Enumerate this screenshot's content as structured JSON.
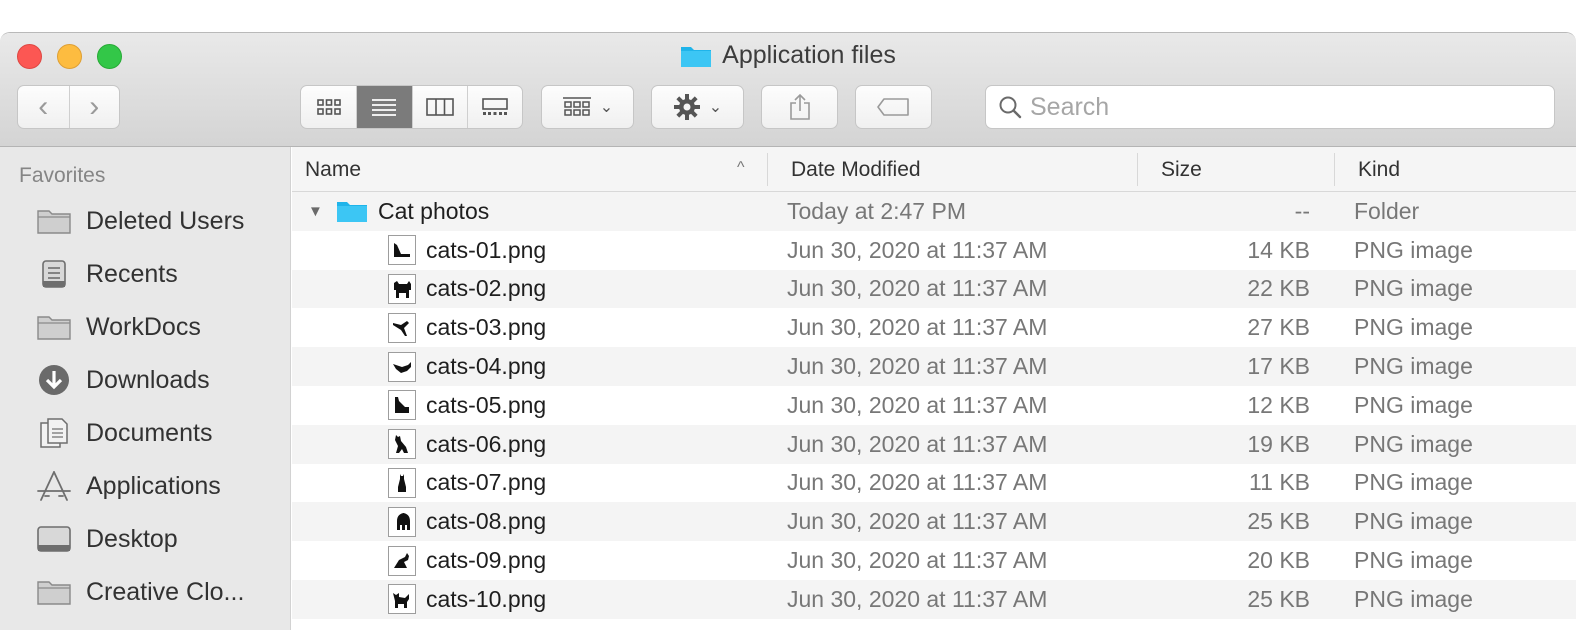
{
  "window": {
    "title": "Application files",
    "colors": {
      "close": "#fc5753",
      "minimize": "#fdbc40",
      "maximize": "#33c748",
      "folder": "#1fb4ea"
    }
  },
  "toolbar": {
    "back_icon": "chevron-left-icon",
    "forward_icon": "chevron-right-icon",
    "views": [
      "icon-view-icon",
      "list-view-icon",
      "column-view-icon",
      "gallery-view-icon"
    ],
    "active_view": "list",
    "group_icon": "group-icon",
    "action_icon": "gear-icon",
    "share_icon": "share-icon",
    "tag_icon": "tag-icon"
  },
  "search": {
    "placeholder": "Search",
    "value": ""
  },
  "sidebar": {
    "heading": "Favorites",
    "items": [
      {
        "label": "Deleted Users",
        "icon": "folder-icon"
      },
      {
        "label": "Recents",
        "icon": "recents-icon"
      },
      {
        "label": "WorkDocs",
        "icon": "folder-icon"
      },
      {
        "label": "Downloads",
        "icon": "download-icon"
      },
      {
        "label": "Documents",
        "icon": "document-icon"
      },
      {
        "label": "Applications",
        "icon": "applications-icon"
      },
      {
        "label": "Desktop",
        "icon": "desktop-icon"
      },
      {
        "label": "Creative Clo...",
        "icon": "folder-icon"
      }
    ]
  },
  "columns": {
    "name": "Name",
    "date": "Date Modified",
    "size": "Size",
    "kind": "Kind",
    "sort_indicator": "^"
  },
  "folder_row": {
    "disclosure": "▼",
    "name": "Cat photos",
    "date": "Today at 2:47 PM",
    "size": "--",
    "kind": "Folder"
  },
  "files": [
    {
      "name": "cats-01.png",
      "date": "Jun 30, 2020 at 11:37 AM",
      "size": "14 KB",
      "kind": "PNG image"
    },
    {
      "name": "cats-02.png",
      "date": "Jun 30, 2020 at 11:37 AM",
      "size": "22 KB",
      "kind": "PNG image"
    },
    {
      "name": "cats-03.png",
      "date": "Jun 30, 2020 at 11:37 AM",
      "size": "27 KB",
      "kind": "PNG image"
    },
    {
      "name": "cats-04.png",
      "date": "Jun 30, 2020 at 11:37 AM",
      "size": "17 KB",
      "kind": "PNG image"
    },
    {
      "name": "cats-05.png",
      "date": "Jun 30, 2020 at 11:37 AM",
      "size": "12 KB",
      "kind": "PNG image"
    },
    {
      "name": "cats-06.png",
      "date": "Jun 30, 2020 at 11:37 AM",
      "size": "19 KB",
      "kind": "PNG image"
    },
    {
      "name": "cats-07.png",
      "date": "Jun 30, 2020 at 11:37 AM",
      "size": "11 KB",
      "kind": "PNG image"
    },
    {
      "name": "cats-08.png",
      "date": "Jun 30, 2020 at 11:37 AM",
      "size": "25 KB",
      "kind": "PNG image"
    },
    {
      "name": "cats-09.png",
      "date": "Jun 30, 2020 at 11:37 AM",
      "size": "20 KB",
      "kind": "PNG image"
    },
    {
      "name": "cats-10.png",
      "date": "Jun 30, 2020 at 11:37 AM",
      "size": "25 KB",
      "kind": "PNG image"
    }
  ]
}
